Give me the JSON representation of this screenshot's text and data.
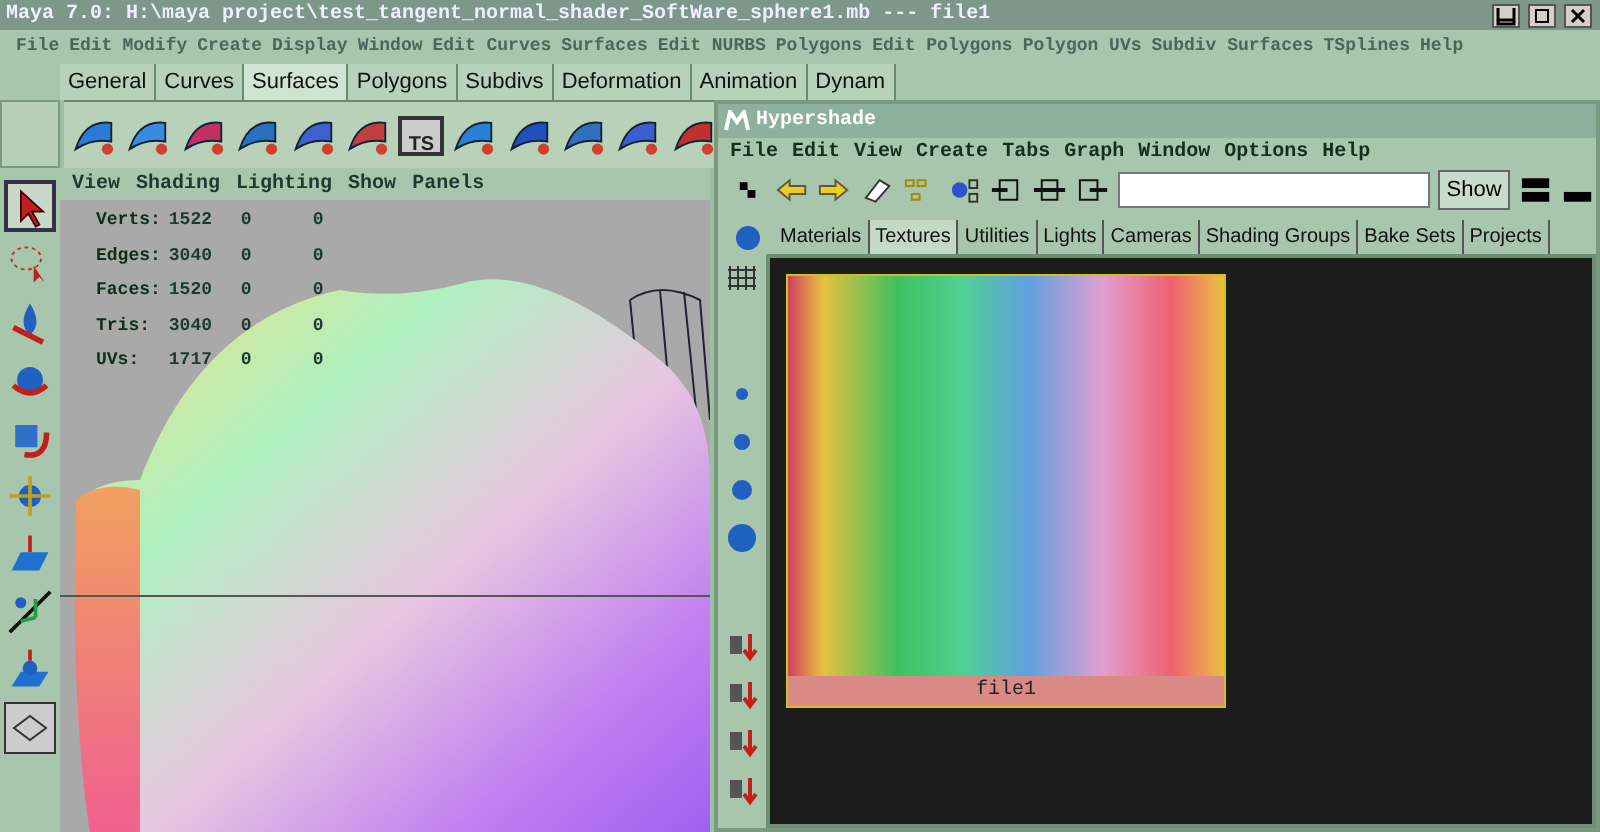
{
  "window": {
    "title": "Maya 7.0: H:\\maya project\\test_tangent_normal_shader_SoftWare_sphere1.mb  ---  file1"
  },
  "menu": [
    "File",
    "Edit",
    "Modify",
    "Create",
    "Display",
    "Window",
    "Edit Curves",
    "Surfaces",
    "Edit NURBS",
    "Polygons",
    "Edit Polygons",
    "Polygon UVs",
    "Subdiv Surfaces",
    "TSplines",
    "Help"
  ],
  "shelf_tabs": [
    {
      "label": "General",
      "selected": false
    },
    {
      "label": "Curves",
      "selected": false
    },
    {
      "label": "Surfaces",
      "selected": true
    },
    {
      "label": "Polygons",
      "selected": false
    },
    {
      "label": "Subdivs",
      "selected": false
    },
    {
      "label": "Deformation",
      "selected": false
    },
    {
      "label": "Animation",
      "selected": false
    },
    {
      "label": "Dynam",
      "selected": false
    }
  ],
  "shelf_tool_label": "TS",
  "toolbox": [
    {
      "kind": "select",
      "selected": true
    },
    {
      "kind": "lasso",
      "selected": false
    },
    {
      "kind": "paint",
      "selected": false
    },
    {
      "kind": "move",
      "selected": false
    },
    {
      "kind": "rotate",
      "selected": false
    },
    {
      "kind": "scale",
      "selected": false
    },
    {
      "kind": "manip",
      "selected": false
    },
    {
      "kind": "soft",
      "selected": false
    },
    {
      "kind": "show",
      "selected": false
    }
  ],
  "viewport": {
    "menu": [
      "View",
      "Shading",
      "Lighting",
      "Show",
      "Panels"
    ],
    "hud": [
      {
        "label": "Verts:",
        "values": [
          "1522",
          "0",
          "0"
        ]
      },
      {
        "label": "Edges:",
        "values": [
          "3040",
          "0",
          "0"
        ]
      },
      {
        "label": "Faces:",
        "values": [
          "1520",
          "0",
          "0"
        ]
      },
      {
        "label": "Tris:",
        "values": [
          "3040",
          "0",
          "0"
        ]
      },
      {
        "label": "UVs:",
        "values": [
          "1717",
          "0",
          "0"
        ]
      }
    ]
  },
  "hypershade": {
    "title": "Hypershade",
    "menu": [
      "File",
      "Edit",
      "View",
      "Create",
      "Tabs",
      "Graph",
      "Window",
      "Options",
      "Help"
    ],
    "show_button": "Show",
    "tabs": [
      {
        "label": "Materials",
        "selected": false
      },
      {
        "label": "Textures",
        "selected": true
      },
      {
        "label": "Utilities",
        "selected": false
      },
      {
        "label": "Lights",
        "selected": false
      },
      {
        "label": "Cameras",
        "selected": false
      },
      {
        "label": "Shading Groups",
        "selected": false
      },
      {
        "label": "Bake Sets",
        "selected": false
      },
      {
        "label": "Projects",
        "selected": false
      }
    ],
    "nodes": [
      {
        "name": "file1",
        "selected": true
      }
    ]
  }
}
